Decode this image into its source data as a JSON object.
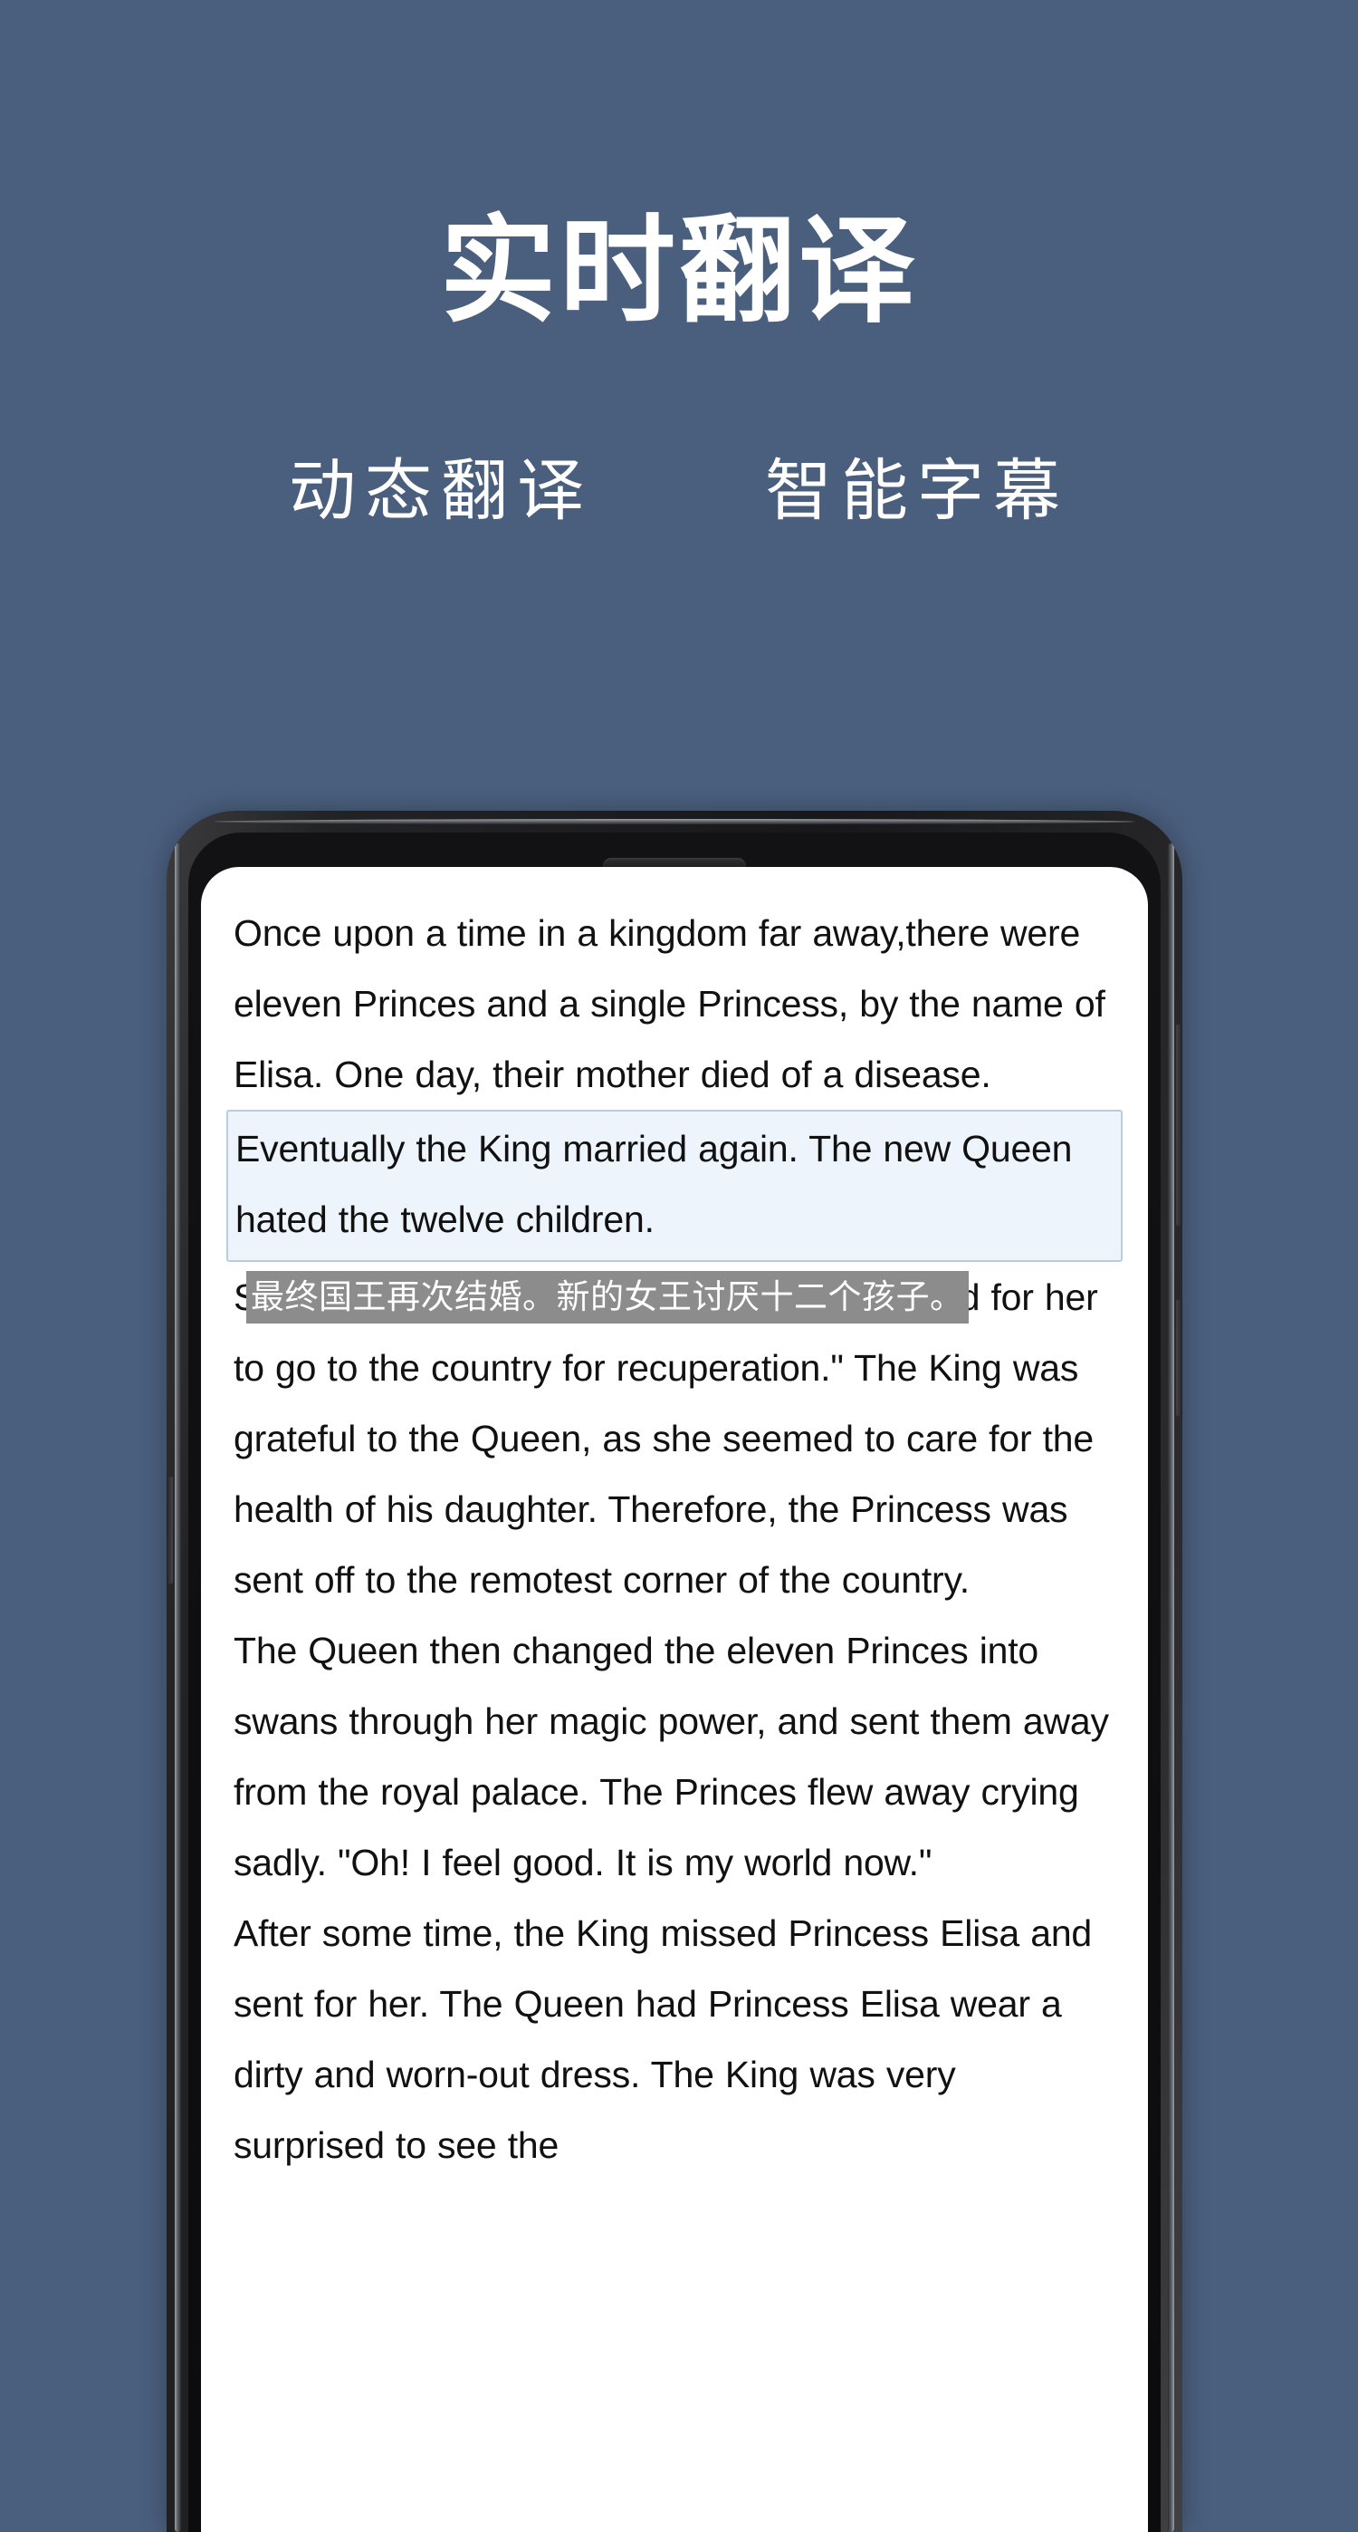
{
  "promo": {
    "title": "实时翻译",
    "subtitles": [
      "动态翻译",
      "智能字幕"
    ],
    "background_color": "#4a5f7e",
    "text_color": "#ffffff"
  },
  "device": {
    "name": "smartphone-mockup",
    "frame_color": "#18181a",
    "screen_color": "#ffffff",
    "earpiece": "earpiece-speaker",
    "buttons": [
      "volume-button-left",
      "power-button-right",
      "volume-button-right"
    ]
  },
  "reader": {
    "paragraphs": [
      {
        "id": "p1",
        "state": "normal",
        "text": "Once upon a time in a kingdom far away,there were eleven Princes and a single Princess, by the name of Elisa. One day, their mother died of a disease."
      },
      {
        "id": "p2",
        "state": "highlighted",
        "text": "Eventually the King married again. The new Queen hated the twelve children."
      },
      {
        "id": "p3",
        "state": "normal",
        "text": "She said to the King, \"I think it would be good for her to go to the country for recuperation.\" The King was grateful to the Queen, as she seemed to care for the health of his daughter. Therefore, the Princess was sent off to the remotest corner of the country."
      },
      {
        "id": "p4",
        "state": "normal",
        "text": "The Queen then changed the eleven Princes into swans through her magic power, and sent them away from the royal palace. The Princes flew away crying sadly. \"Oh! I feel good. It is my world now.\""
      },
      {
        "id": "p5",
        "state": "normal",
        "text": "After some time, the King missed Princess Elisa and sent for her. The Queen had Princess Elisa wear a dirty and worn-out dress. The King was very surprised to see the"
      }
    ],
    "translation_tooltip": {
      "text": "最终国王再次结婚。新的女王讨厌十二个孩子。",
      "background_color": "#8c8c8c",
      "text_color": "#ffffff"
    },
    "highlight_colors": {
      "fill": "#eef4fb",
      "border": "#b9cde2"
    },
    "body_text_color": "#111111"
  }
}
